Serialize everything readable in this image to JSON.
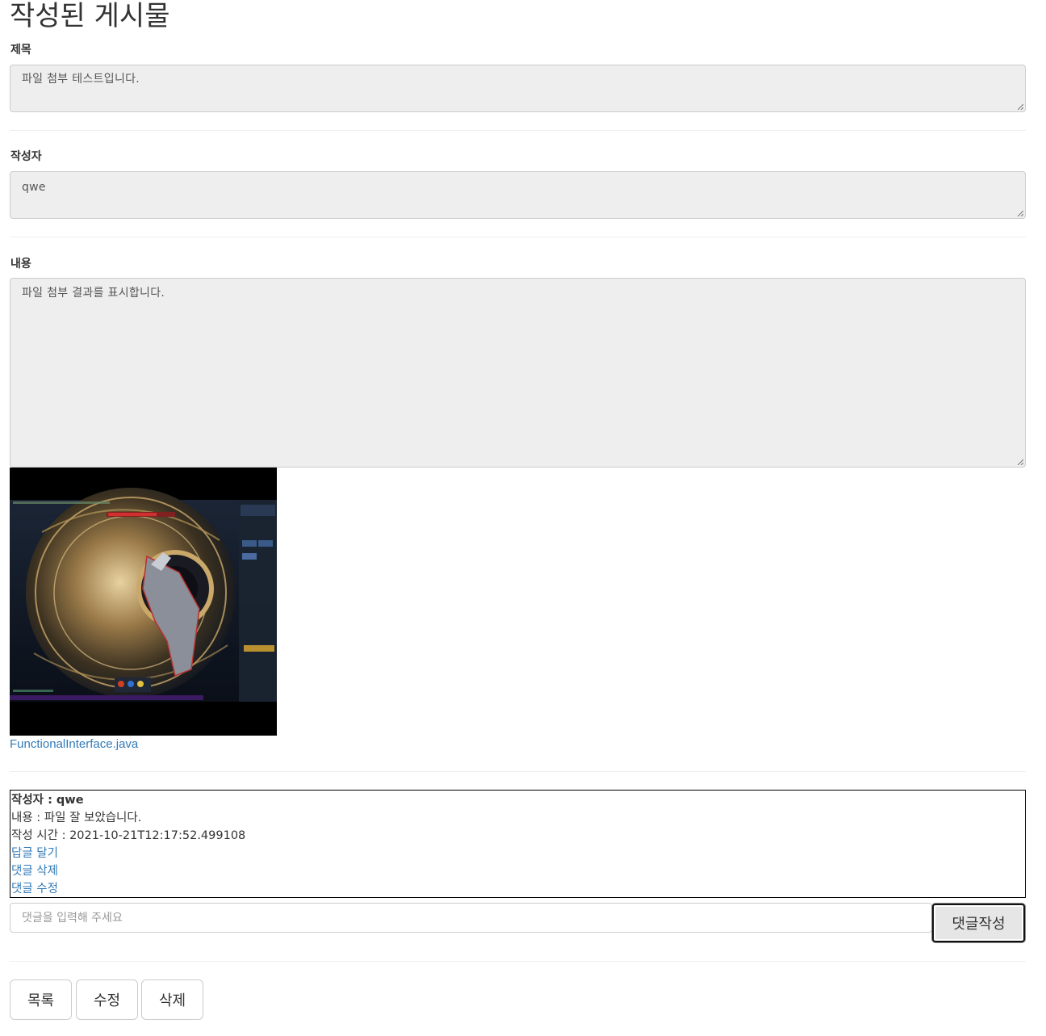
{
  "page": {
    "title": "작성된 게시물"
  },
  "post": {
    "title_label": "제목",
    "title_value": "파일 첨부 테스트입니다.",
    "author_label": "작성자",
    "author_value": "qwe",
    "content_label": "내용",
    "content_value": "파일 첨부 결과를 표시합니다."
  },
  "attachment": {
    "file_name": "FunctionalInterface.java"
  },
  "comment": {
    "author_line": "작성자 : qwe",
    "content_line": "내용 : 파일 잘 보았습니다.",
    "time_line": "작성 시간 : 2021-10-21T12:17:52.499108",
    "reply_link": "답글 달기",
    "delete_link": "댓글 삭제",
    "edit_link": "댓글 수정"
  },
  "comment_form": {
    "placeholder": "댓글을 입력해 주세요",
    "submit_label": "댓글작성"
  },
  "actions": {
    "list_label": "목록",
    "edit_label": "수정",
    "delete_label": "삭제"
  },
  "colors": {
    "link": "#337ab7",
    "readonly_bg": "#eeeeee",
    "border": "#cccccc"
  }
}
